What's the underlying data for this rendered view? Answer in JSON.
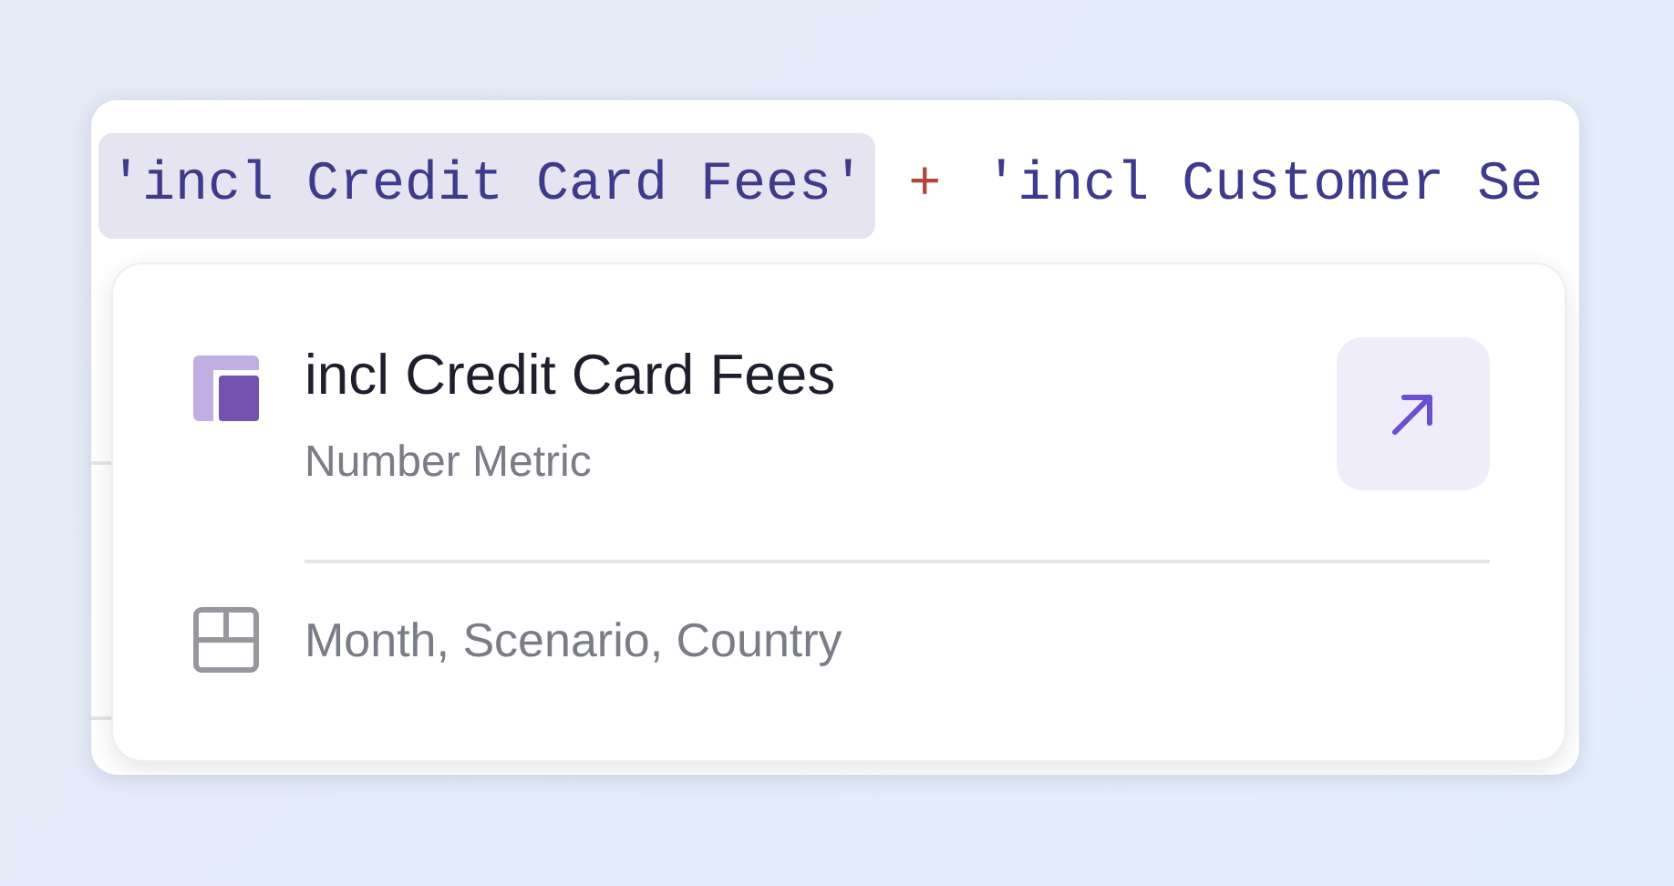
{
  "editor": {
    "tokens": [
      {
        "kind": "reference",
        "text": "'incl Credit Card Fees'",
        "selected": true
      },
      {
        "kind": "operator",
        "text": "+"
      },
      {
        "kind": "reference",
        "text": "'incl Customer Se",
        "selected": false
      }
    ]
  },
  "popup": {
    "title": "incl Credit Card Fees",
    "subtitle": "Number Metric",
    "dimensions": "Month, Scenario, Country"
  }
}
